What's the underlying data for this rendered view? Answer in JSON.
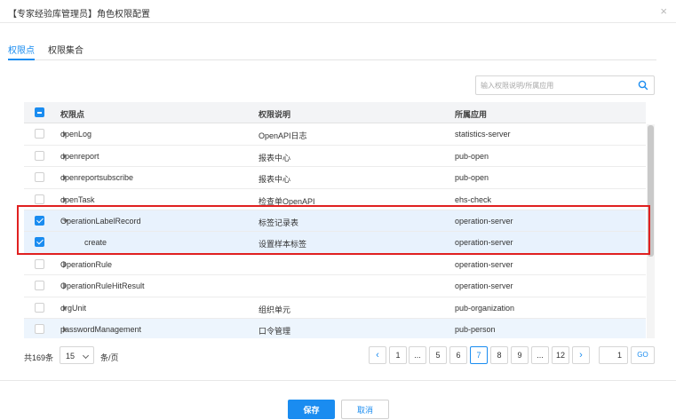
{
  "dialog": {
    "title": "【专家经验库管理员】角色权限配置",
    "close_icon": "×"
  },
  "tabs": [
    {
      "label": "权限点",
      "active": true
    },
    {
      "label": "权限集合",
      "active": false
    }
  ],
  "search": {
    "placeholder": "输入权限说明/所属应用",
    "value": ""
  },
  "table": {
    "columns": [
      "权限点",
      "权限说明",
      "所属应用"
    ],
    "header_checkbox": "indeterminate",
    "rows": [
      {
        "point": "openLog",
        "desc": "OpenAPI日志",
        "app": "statistics-server",
        "checked": false,
        "expand": "collapsed",
        "child": false
      },
      {
        "point": "openreport",
        "desc": "报表中心",
        "app": "pub-open",
        "checked": false,
        "expand": "collapsed",
        "child": false
      },
      {
        "point": "openreportsubscribe",
        "desc": "报表中心",
        "app": "pub-open",
        "checked": false,
        "expand": "collapsed",
        "child": false
      },
      {
        "point": "openTask",
        "desc": "检查单OpenAPI",
        "app": "ehs-check",
        "checked": false,
        "expand": "collapsed",
        "child": false
      },
      {
        "point": "OperationLabelRecord",
        "desc": "标签记录表",
        "app": "operation-server",
        "checked": true,
        "expand": "expanded",
        "child": false
      },
      {
        "point": "create",
        "desc": "设置样本标签",
        "app": "operation-server",
        "checked": true,
        "expand": "none",
        "child": true
      },
      {
        "point": "OperationRule",
        "desc": "",
        "app": "operation-server",
        "checked": false,
        "expand": "collapsed",
        "child": false
      },
      {
        "point": "OperationRuleHitResult",
        "desc": "",
        "app": "operation-server",
        "checked": false,
        "expand": "collapsed",
        "child": false
      },
      {
        "point": "orgUnit",
        "desc": "组织单元",
        "app": "pub-organization",
        "checked": false,
        "expand": "collapsed",
        "child": false
      },
      {
        "point": "passwordManagement",
        "desc": "口令管理",
        "app": "pub-person",
        "checked": false,
        "expand": "collapsed",
        "child": false
      }
    ]
  },
  "pagination": {
    "total_text": "共169条",
    "page_size": "15",
    "per_page_text": "条/页",
    "prev": "‹",
    "next": "›",
    "pages": [
      "1",
      "...",
      "5",
      "6",
      "7",
      "8",
      "9",
      "...",
      "12"
    ],
    "current_page": "7",
    "jump_value": "1",
    "go_label": "GO"
  },
  "footer": {
    "save_label": "保存",
    "cancel_label": "取消"
  },
  "colors": {
    "accent": "#1a8cf0",
    "highlight_box": "#e02020"
  }
}
